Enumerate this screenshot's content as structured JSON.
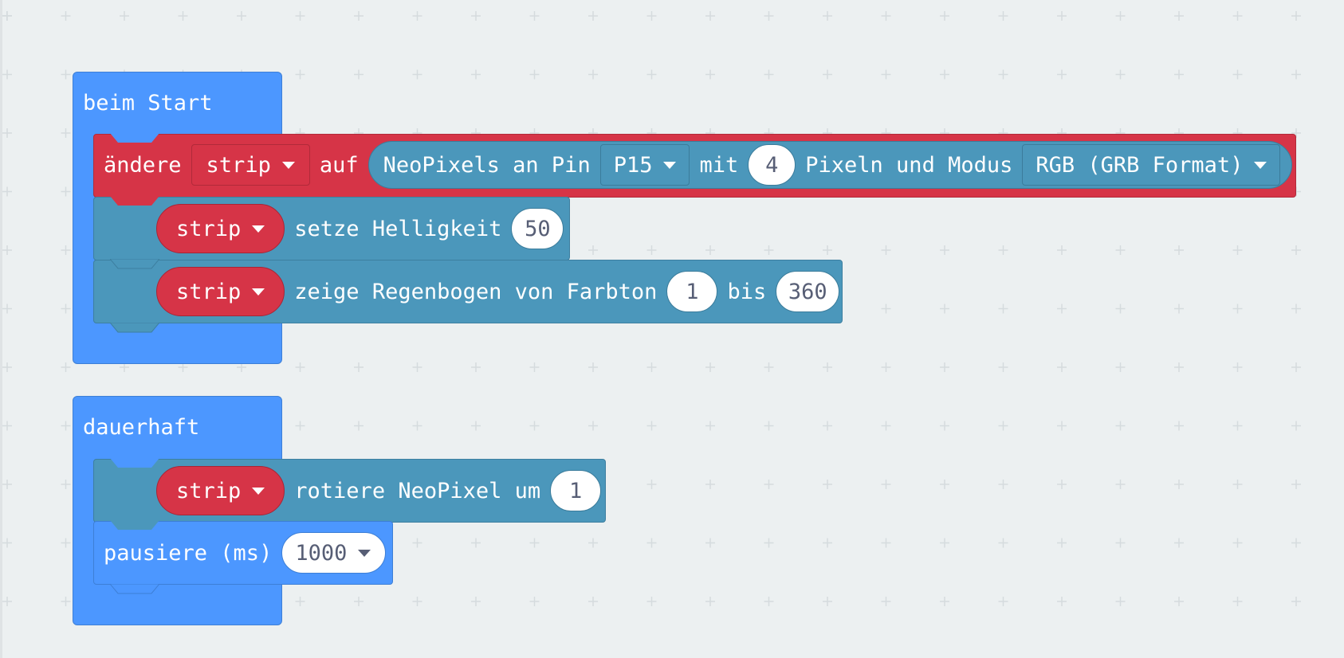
{
  "colors": {
    "workspace_bg": "#ecf0f1",
    "event_blue": "#4c97ff",
    "neopixel_red": "#d63447",
    "neopixel_teal": "#4b97bb",
    "value_text": "#575e75"
  },
  "blocks": {
    "on_start": {
      "title": "beim Start",
      "set_strip": {
        "verb": "ändere",
        "variable": "strip",
        "to": "auf",
        "create": {
          "prefix": "NeoPixels an Pin",
          "pin": "P15",
          "with": "mit",
          "count": "4",
          "mode_label": "Pixeln und Modus",
          "mode": "RGB (GRB Format)"
        }
      },
      "brightness": {
        "variable": "strip",
        "label": "setze Helligkeit",
        "value": "50"
      },
      "rainbow": {
        "variable": "strip",
        "label": "zeige Regenbogen von Farbton",
        "from": "1",
        "to_label": "bis",
        "to": "360"
      }
    },
    "forever": {
      "title": "dauerhaft",
      "rotate": {
        "variable": "strip",
        "label": "rotiere NeoPixel um",
        "value": "1"
      },
      "pause": {
        "label": "pausiere (ms)",
        "value": "1000"
      }
    }
  }
}
